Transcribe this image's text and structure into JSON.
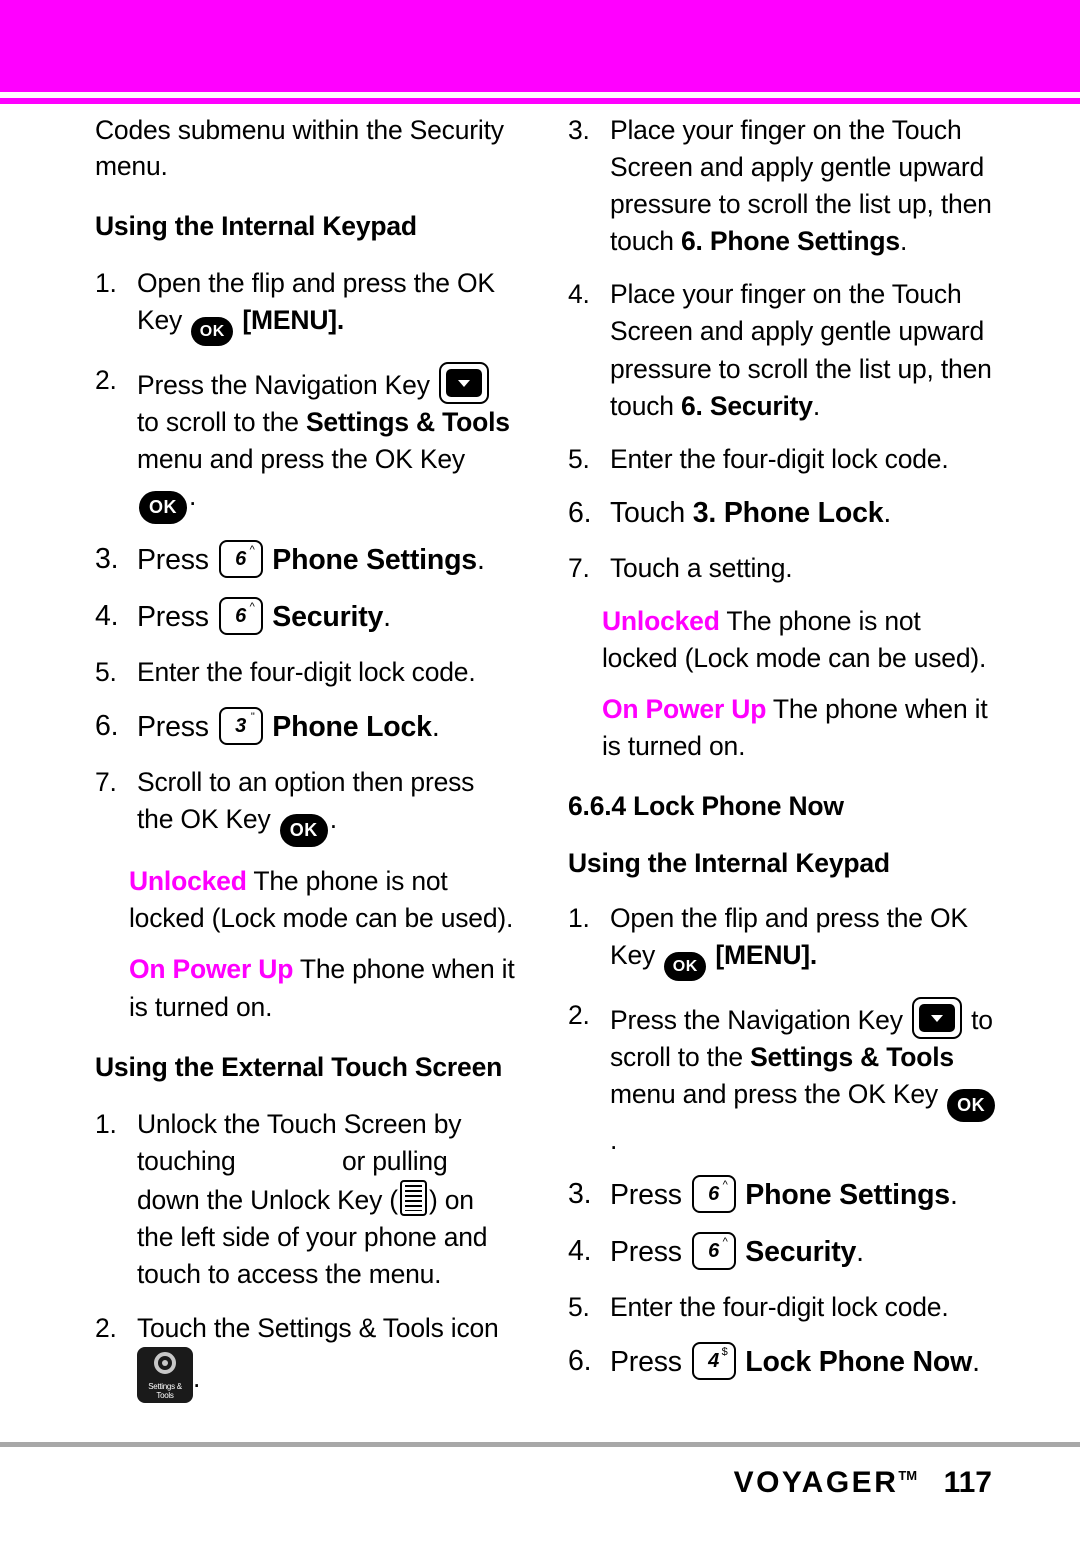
{
  "page": {
    "number": "117",
    "brand": "VOYAGER",
    "brand_tm": "TM",
    "accent_color": "#ff00ff",
    "band_color": "#ff00ff",
    "rule_color": "#a8a8a8"
  },
  "left_column": {
    "intro": "Codes submenu within the Security menu.",
    "heading_keypad": "Using the Internal Keypad",
    "steps_keypad": {
      "s1_num": "1.",
      "s1_a": "Open the flip and press the OK Key",
      "s1_b": "[MENU].",
      "s2_num": "2.",
      "s2_a": "Press the Navigation Key",
      "s2_b": "to scroll to the",
      "s2_bold": "Settings & Tools",
      "s2_c": "menu and press the OK Key",
      "s2_d": ".",
      "s3_num": "3.",
      "s3_a": "Press",
      "s3_bold": "Phone Settings",
      "s3_b": ".",
      "s4_num": "4.",
      "s4_a": "Press",
      "s4_bold": "Security",
      "s4_b": ".",
      "s5_num": "5.",
      "s5_a": "Enter the four-digit lock code.",
      "s6_num": "6.",
      "s6_a": "Press",
      "s6_bold": "Phone Lock",
      "s6_b": ".",
      "s7_num": "7.",
      "s7_a": "Scroll to an option then press the OK Key",
      "s7_b": "."
    },
    "options": {
      "unlocked_label": "Unlocked",
      "unlocked_text": "The phone is not locked (Lock mode can be used).",
      "onpowerup_label": "On Power Up",
      "onpowerup_text": "The phone when it is turned on."
    },
    "heading_touch": "Using the External Touch Screen",
    "steps_touch": {
      "s1_num": "1.",
      "s1_a": "Unlock the Touch Screen by touching",
      "s1_b": "or pulling down the Unlock Key (",
      "s1_c": ") on the left side of your phone and touch to access the menu.",
      "s2_num": "2.",
      "s2_a": "Touch the Settings & Tools icon",
      "s2_b": "."
    },
    "settings_icon_label_1": "Settings &",
    "settings_icon_label_2": "Tools"
  },
  "right_column": {
    "steps_touch_cont": {
      "s3_num": "3.",
      "s3_a": "Place your finger on the Touch Screen and apply gentle upward pressure to scroll the list up, then touch",
      "s3_bold": "6. Phone Settings",
      "s3_b": ".",
      "s4_num": "4.",
      "s4_a": "Place your finger on the Touch Screen and apply gentle upward pressure to scroll the list up, then touch",
      "s4_bold": "6. Security",
      "s4_b": ".",
      "s5_num": "5.",
      "s5_a": "Enter the four-digit lock code.",
      "s6_num": "6.",
      "s6_a": "Touch",
      "s6_bold": "3. Phone Lock",
      "s6_b": ".",
      "s7_num": "7.",
      "s7_a": "Touch a setting."
    },
    "options": {
      "unlocked_label": "Unlocked",
      "unlocked_text": "The phone is not locked (Lock mode can be used).",
      "onpowerup_label": "On Power Up",
      "onpowerup_text": "The phone when it is turned on."
    },
    "section_heading": "6.6.4 Lock Phone Now",
    "heading_keypad": "Using the Internal Keypad",
    "steps_keypad": {
      "s1_num": "1.",
      "s1_a": "Open the flip and press the OK Key",
      "s1_b": "[MENU].",
      "s2_num": "2.",
      "s2_a": "Press the Navigation Key",
      "s2_b": "to scroll to the",
      "s2_bold": "Settings & Tools",
      "s2_c": "menu and press the OK Key",
      "s2_d": ".",
      "s3_num": "3.",
      "s3_a": "Press",
      "s3_bold": "Phone Settings",
      "s3_b": ".",
      "s4_num": "4.",
      "s4_a": "Press",
      "s4_bold": "Security",
      "s4_b": ".",
      "s5_num": "5.",
      "s5_a": "Enter the four-digit lock code.",
      "s6_num": "6.",
      "s6_a": "Press",
      "s6_bold": "Lock Phone Now",
      "s6_b": "."
    }
  },
  "keys": {
    "ok": "OK",
    "six": "6",
    "six_sup": "^",
    "three": "3",
    "three_sup": "\"",
    "four": "4",
    "four_sup": "$"
  }
}
